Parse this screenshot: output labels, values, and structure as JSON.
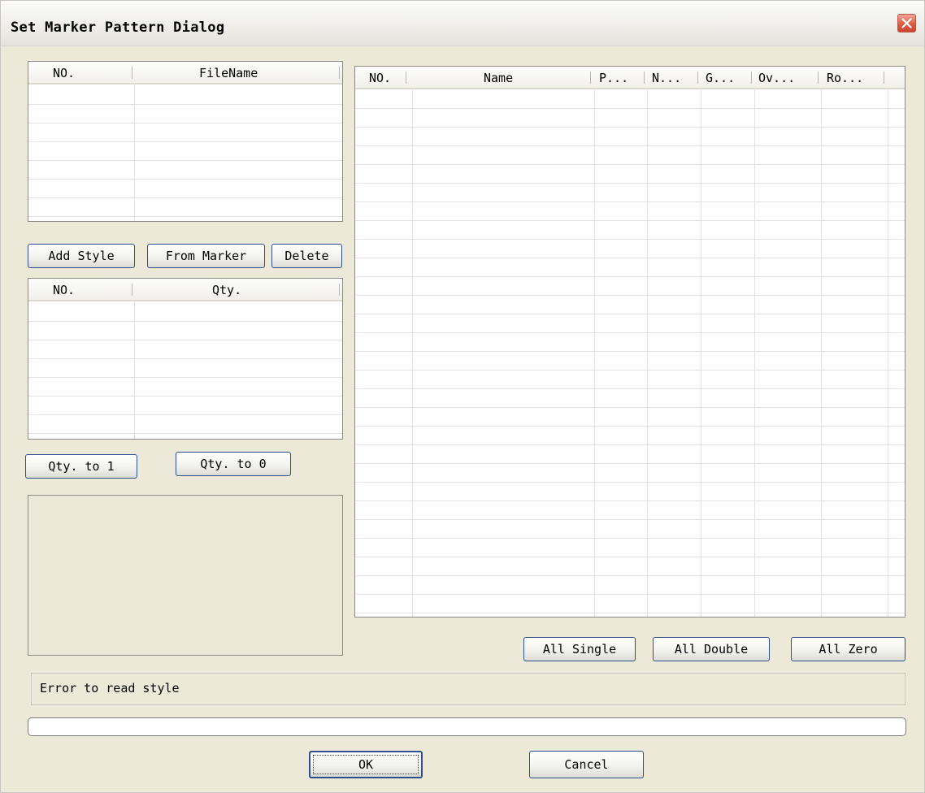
{
  "window": {
    "title": "Set Marker Pattern Dialog",
    "close_icon": "close-icon"
  },
  "file_table": {
    "columns": [
      "NO.",
      "FileName"
    ],
    "rows": []
  },
  "style_buttons": {
    "add_style": "Add Style",
    "from_marker": "From Marker",
    "delete": "Delete"
  },
  "qty_table": {
    "columns": [
      "NO.",
      "Qty."
    ],
    "rows": []
  },
  "qty_buttons": {
    "qty_to_1": "Qty. to 1",
    "qty_to_0": "Qty. to 0"
  },
  "pattern_table": {
    "columns": [
      "NO.",
      "Name",
      "P...",
      "N...",
      "G...",
      "Ov...",
      "Ro..."
    ],
    "rows": []
  },
  "pattern_buttons": {
    "all_single": "All Single",
    "all_double": "All Double",
    "all_zero": "All Zero"
  },
  "status_text": "Error to read style",
  "progress": {
    "value": 0
  },
  "footer": {
    "ok": "OK",
    "cancel": "Cancel"
  },
  "colors": {
    "dialog_bg": "#ece9d8",
    "button_border": "#2f4f90",
    "close_button": "#de5c44"
  }
}
